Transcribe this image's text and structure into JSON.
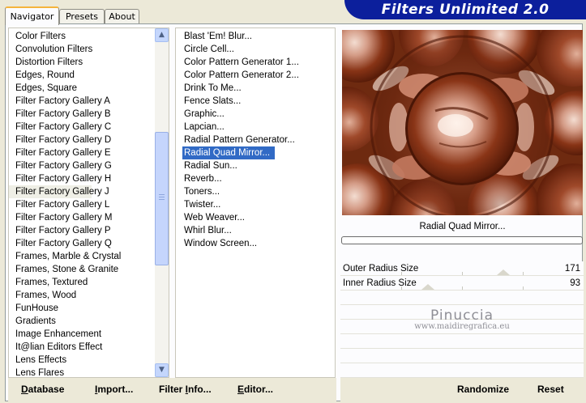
{
  "tabs": [
    {
      "label": "Navigator",
      "active": true
    },
    {
      "label": "Presets",
      "active": false
    },
    {
      "label": "About",
      "active": false
    }
  ],
  "banner": {
    "title": "Filters Unlimited 2.0"
  },
  "categories": [
    "Color Filters",
    "Convolution Filters",
    "Distortion Filters",
    "Edges, Round",
    "Edges, Square",
    "Filter Factory Gallery A",
    "Filter Factory Gallery B",
    "Filter Factory Gallery C",
    "Filter Factory Gallery D",
    "Filter Factory Gallery E",
    "Filter Factory Gallery G",
    "Filter Factory Gallery H",
    "Filter Factory Gallery J",
    "Filter Factory Gallery L",
    "Filter Factory Gallery M",
    "Filter Factory Gallery P",
    "Filter Factory Gallery Q",
    "Frames, Marble & Crystal",
    "Frames, Stone & Granite",
    "Frames, Textured",
    "Frames, Wood",
    "FunHouse",
    "Gradients",
    "Image Enhancement",
    "It@lian Editors Effect",
    "Lens Effects",
    "Lens Flares"
  ],
  "selected_category": "Filter Factory Gallery J",
  "filters": [
    "Blast 'Em! Blur...",
    "Circle Cell...",
    "Color Pattern Generator 1...",
    "Color Pattern Generator 2...",
    "Drink To Me...",
    "Fence Slats...",
    "Graphic...",
    "Lapcian...",
    "Radial Pattern Generator...",
    "Radial Quad Mirror...",
    "Radial Sun...",
    "Reverb...",
    "Toners...",
    "Twister...",
    "Web Weaver...",
    "Whirl Blur...",
    "Window Screen..."
  ],
  "selected_filter": "Radial Quad Mirror...",
  "preview": {
    "filter_name": "Radial Quad Mirror...",
    "progress": 0
  },
  "params": [
    {
      "label": "Outer Radius Size",
      "value": "171"
    },
    {
      "label": "Inner Radius Size",
      "value": "93"
    }
  ],
  "param_slider_levels": [
    0.67,
    0.36
  ],
  "watermark": {
    "line1": "Pinuccia",
    "line2": "www.maidiregrafica.eu"
  },
  "buttons": {
    "database": {
      "u": "D",
      "rest": "atabase"
    },
    "import": {
      "u": "I",
      "rest": "mport..."
    },
    "filterinfo": {
      "pre": "Filter ",
      "u": "I",
      "rest": "nfo..."
    },
    "editor": {
      "u": "E",
      "rest": "ditor..."
    },
    "randomize": "Randomize",
    "reset": "Reset"
  },
  "colors": {
    "accent": "#0c1f9c",
    "selection": "#316ac5"
  },
  "icons": {
    "scroll_up": "chevron-up-icon",
    "scroll_down": "chevron-down-icon"
  }
}
